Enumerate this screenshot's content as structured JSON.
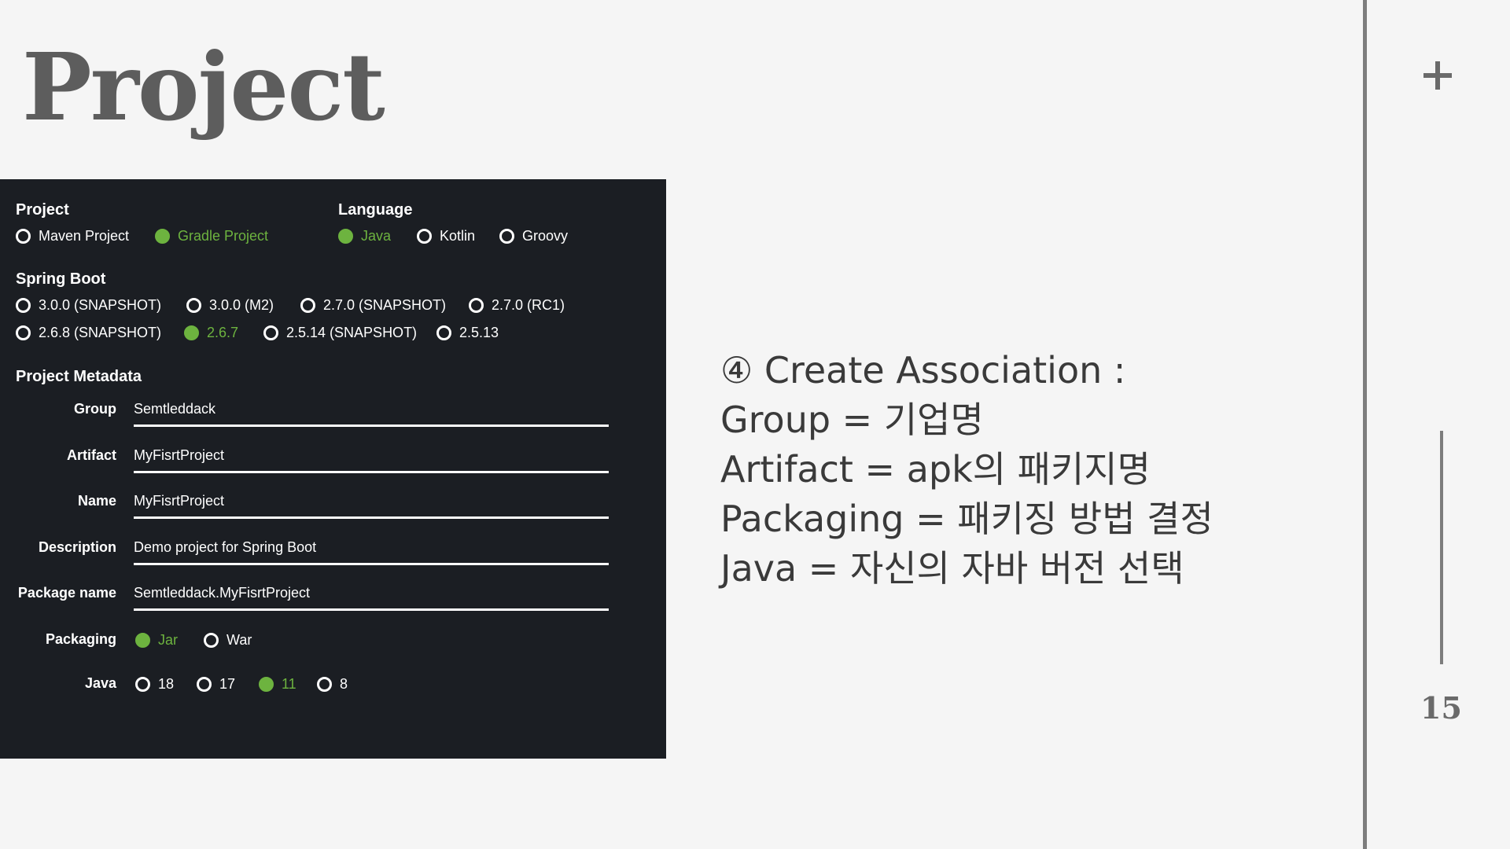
{
  "slide": {
    "title": "Project",
    "page_number": "15",
    "notes": [
      "④ Create Association :",
      "Group = 기업명",
      "Artifact = apk의 패키지명",
      "Packaging = 패키징 방법 결정",
      "Java = 자신의 자바 버전 선택"
    ]
  },
  "initializr": {
    "project": {
      "heading": "Project",
      "options": [
        {
          "label": "Maven Project",
          "selected": false
        },
        {
          "label": "Gradle Project",
          "selected": true
        }
      ]
    },
    "language": {
      "heading": "Language",
      "options": [
        {
          "label": "Java",
          "selected": true
        },
        {
          "label": "Kotlin",
          "selected": false
        },
        {
          "label": "Groovy",
          "selected": false
        }
      ]
    },
    "spring_boot": {
      "heading": "Spring Boot",
      "options": [
        {
          "label": "3.0.0 (SNAPSHOT)",
          "selected": false
        },
        {
          "label": "3.0.0 (M2)",
          "selected": false
        },
        {
          "label": "2.7.0 (SNAPSHOT)",
          "selected": false
        },
        {
          "label": "2.7.0 (RC1)",
          "selected": false
        },
        {
          "label": "2.6.8 (SNAPSHOT)",
          "selected": false
        },
        {
          "label": "2.6.7",
          "selected": true
        },
        {
          "label": "2.5.14 (SNAPSHOT)",
          "selected": false
        },
        {
          "label": "2.5.13",
          "selected": false
        }
      ]
    },
    "metadata": {
      "heading": "Project Metadata",
      "fields": [
        {
          "label": "Group",
          "value": "Semtleddack"
        },
        {
          "label": "Artifact",
          "value": "MyFisrtProject"
        },
        {
          "label": "Name",
          "value": "MyFisrtProject"
        },
        {
          "label": "Description",
          "value": "Demo project for Spring Boot"
        },
        {
          "label": "Package name",
          "value": "Semtleddack.MyFisrtProject"
        }
      ],
      "packaging": {
        "label": "Packaging",
        "options": [
          {
            "label": "Jar",
            "selected": true
          },
          {
            "label": "War",
            "selected": false
          }
        ]
      },
      "java": {
        "label": "Java",
        "options": [
          {
            "label": "18",
            "selected": false
          },
          {
            "label": "17",
            "selected": false
          },
          {
            "label": "11",
            "selected": true
          },
          {
            "label": "8",
            "selected": false
          }
        ]
      }
    }
  },
  "colors": {
    "panel_bg": "#1b1e23",
    "accent_green": "#6db33f",
    "title_gray": "#5d5d5d",
    "slide_bg": "#f5f5f5"
  }
}
